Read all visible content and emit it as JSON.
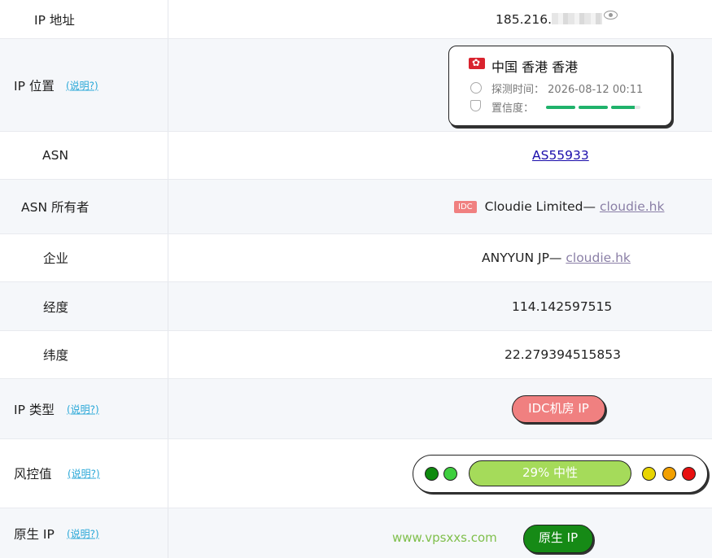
{
  "rows": {
    "ip_address": {
      "label": "IP 地址",
      "value_prefix": "185.216."
    },
    "ip_location": {
      "label": "IP 位置",
      "help": "(说明?)",
      "country": "中国 香港 香港",
      "probe_time_label": "探测时间：",
      "probe_time": "2026-08-12 00:11",
      "confidence_label": "置信度：",
      "confidence_segments": [
        1.0,
        1.0,
        0.8
      ]
    },
    "asn": {
      "label": "ASN",
      "value": "AS55933"
    },
    "asn_owner": {
      "label": "ASN 所有者",
      "badge": "IDC",
      "name": "Cloudie Limited—",
      "domain": "cloudie.hk"
    },
    "enterprise": {
      "label": "企业",
      "name": "ANYYUN JP—",
      "domain": "cloudie.hk"
    },
    "longitude": {
      "label": "经度",
      "value": "114.142597515"
    },
    "latitude": {
      "label": "纬度",
      "value": "22.279394515853"
    },
    "ip_type": {
      "label": "IP 类型",
      "help": "(说明?)",
      "value": "IDC机房 IP",
      "color": "#f08080"
    },
    "risk": {
      "label": "风控值",
      "help": "(说明?)",
      "value": "29%  中性",
      "percent": 29,
      "dot_colors": [
        "#0e8a0e",
        "#3fcf3f",
        "#e8d400",
        "#f2a000",
        "#e81010"
      ]
    },
    "native_ip": {
      "label": "原生 IP",
      "help": "(说明?)",
      "value": "原生 IP",
      "color": "#168a16"
    }
  },
  "watermark": "www.vpsxxs.com",
  "icons": {
    "reveal": "eye-icon",
    "clock": "clock-icon",
    "shield": "shield-check-icon",
    "flag": "hong-kong-flag-icon"
  }
}
